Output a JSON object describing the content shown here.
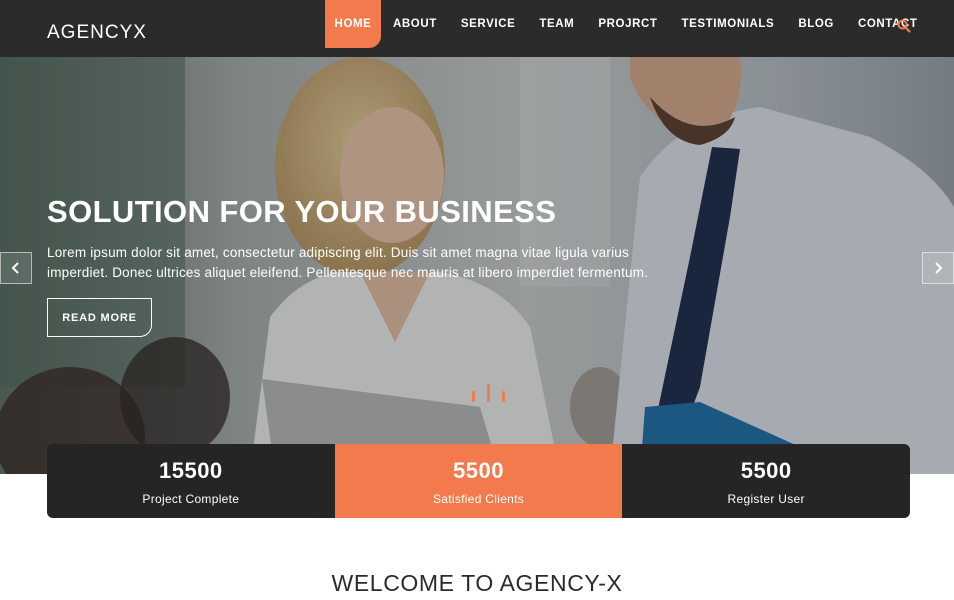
{
  "nav": {
    "brand": "AGENCYX",
    "items": [
      {
        "label": "HOME",
        "active": true
      },
      {
        "label": "ABOUT"
      },
      {
        "label": "SERVICE"
      },
      {
        "label": "TEAM"
      },
      {
        "label": "PROJRCT"
      },
      {
        "label": "TESTIMONIALS"
      },
      {
        "label": "BLOG"
      },
      {
        "label": "CONTACT"
      }
    ],
    "search_icon": "search-icon"
  },
  "hero": {
    "title": "SOLUTION FOR YOUR BUSINESS",
    "text": "Lorem ipsum dolor sit amet, consectetur adipiscing elit. Duis sit amet magna vitae ligula varius imperdiet. Donec ultrices aliquet eleifend. Pellentesque nec mauris at libero imperdiet fermentum.",
    "button_label": "READ MORE",
    "prev_icon": "chevron-left-icon",
    "next_icon": "chevron-right-icon"
  },
  "stats": [
    {
      "value": "15500",
      "label": "Project Complete"
    },
    {
      "value": "5500",
      "label": "Satisfied Clients"
    },
    {
      "value": "5500",
      "label": "Register User"
    }
  ],
  "welcome": {
    "title": "WELCOME TO AGENCY-X"
  },
  "colors": {
    "accent": "#f27a4c",
    "navbar": "#2b2b2b",
    "stats_dark": "#252525"
  }
}
